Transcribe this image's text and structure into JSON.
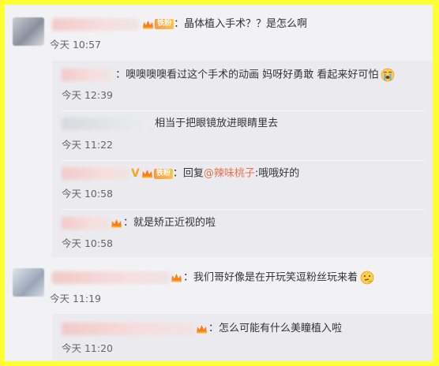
{
  "badges": {
    "fan": "铁粉",
    "verified": "V"
  },
  "comments": [
    {
      "id": "c1",
      "text": "晶体植入手术？？是怎么啊",
      "time": "今天 10:57"
    },
    {
      "id": "r1",
      "text": "噢噢噢噢看过这个手术的动画 妈呀好勇敢 看起来好可怕",
      "emoji": "crying-face-icon",
      "time": "今天 12:39"
    },
    {
      "id": "r2",
      "text": "相当于把眼镜放进眼睛里去",
      "time": "今天 11:22"
    },
    {
      "id": "r3",
      "reply_prefix": "回复",
      "mention": "@辣味桃子",
      "text": ":哦哦好的",
      "time": "今天 10:58"
    },
    {
      "id": "r4",
      "text": "就是矫正近视的啦",
      "time": "今天 10:58"
    },
    {
      "id": "c2",
      "text": "我们哥好像是在开玩笑逗粉丝玩来着",
      "emoji": "thinking-face-icon",
      "time": "今天 11:19"
    },
    {
      "id": "r5",
      "text": "怎么可能有什么美瞳植入啦",
      "time": "今天 11:20"
    }
  ],
  "colors": {
    "mention": "#eb7350",
    "frame_border": "#ffff33",
    "reply_bg": "#ebebef"
  }
}
